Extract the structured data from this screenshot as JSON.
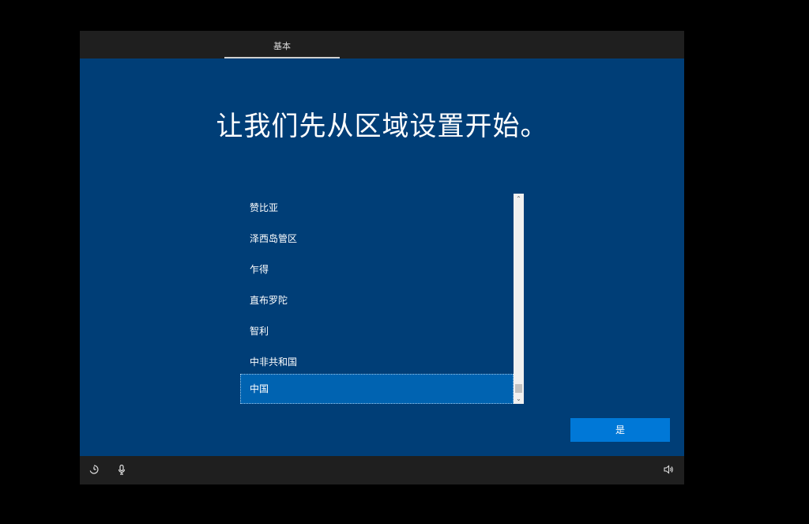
{
  "header": {
    "tab_label": "基本"
  },
  "main": {
    "title": "让我们先从区域设置开始。",
    "region_list": {
      "items": [
        "赞比亚",
        "泽西岛管区",
        "乍得",
        "直布罗陀",
        "智利",
        "中非共和国",
        "中国"
      ],
      "selected": "中国"
    },
    "yes_button_label": "是"
  },
  "footer": {
    "icons": [
      "ease-of-access-icon",
      "microphone-icon",
      "volume-icon"
    ]
  },
  "colors": {
    "background": "#003e77",
    "bar": "#1f1f1f",
    "selected_item": "#0063b1",
    "accent_button": "#0078d7"
  }
}
